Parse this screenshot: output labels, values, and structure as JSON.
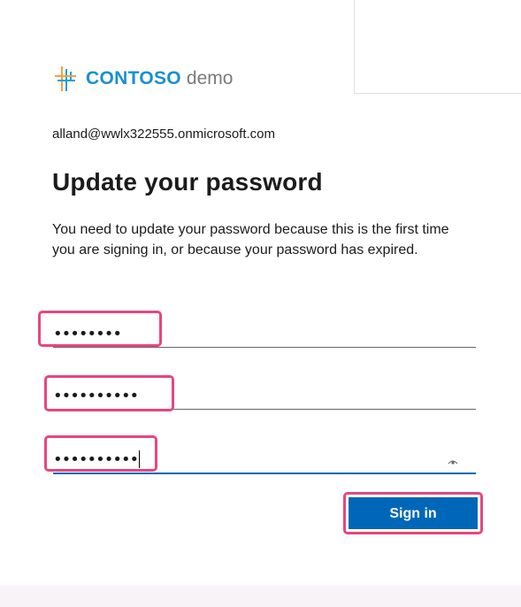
{
  "header": {
    "logo_brand": "CONTOSO",
    "logo_suffix": "demo"
  },
  "account": {
    "email": "alland@wwlx322555.onmicrosoft.com"
  },
  "form": {
    "title": "Update your password",
    "description": "You need to update your password because this is the first time you are signing in, or because your password has expired.",
    "current_password": "••••••••",
    "new_password": "••••••••••",
    "confirm_password": "••••••••••",
    "reveal_icon": "eye-icon",
    "submit_label": "Sign in"
  },
  "colors": {
    "accent": "#0067b8",
    "highlight": "#e8467c",
    "logo_blue": "#1a8fd0",
    "logo_orange": "#f2a13a"
  }
}
